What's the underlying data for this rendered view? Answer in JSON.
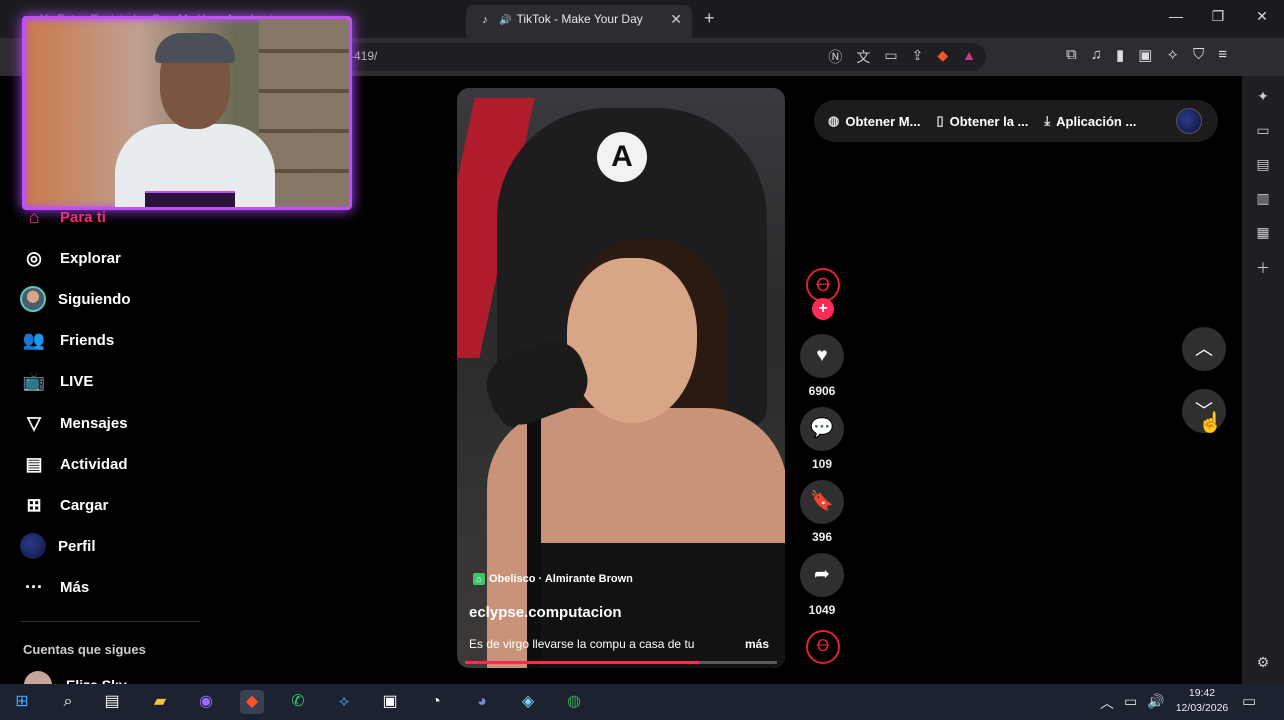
{
  "browser": {
    "inactive_tab_title": "Ya Estoy Enviciado . D ... My Hero Academia",
    "active_tab_title": "TikTok - Make Your Day",
    "tab_close": "✕",
    "new_tab": "+",
    "url": "...-419/",
    "window_controls": {
      "minimize": "—",
      "maximize": "❐",
      "close": "✕"
    }
  },
  "webcam_overlay": {
    "accent_color": "#c44dff"
  },
  "nav": {
    "items": [
      {
        "label": "Para ti",
        "icon": "home-icon",
        "active": true
      },
      {
        "label": "Explorar",
        "icon": "compass-icon"
      },
      {
        "label": "Siguiendo",
        "icon": "avatar"
      },
      {
        "label": "Friends",
        "icon": "friends-icon"
      },
      {
        "label": "LIVE",
        "icon": "live-icon"
      },
      {
        "label": "Mensajes",
        "icon": "send-icon"
      },
      {
        "label": "Actividad",
        "icon": "activity-icon"
      },
      {
        "label": "Cargar",
        "icon": "upload-icon"
      },
      {
        "label": "Perfil",
        "icon": "avatar"
      },
      {
        "label": "Más",
        "icon": "more-icon"
      }
    ],
    "following_title": "Cuentas que sigues",
    "following_users": [
      {
        "name": "Eliza Sky"
      }
    ]
  },
  "top_actions": {
    "items": [
      {
        "label": "Obtener M...",
        "icon": "coin-icon"
      },
      {
        "label": "Obtener la ...",
        "icon": "phone-icon"
      },
      {
        "label": "Aplicación ...",
        "icon": "download-icon"
      }
    ]
  },
  "video": {
    "location_tag": "Obelisco · Almirante Brown",
    "username": "eclypse.computacion",
    "caption": "Es de virgo llevarse la compu a casa de tu",
    "more_label": "más",
    "progress": 0.75,
    "chair_logo": "A"
  },
  "actions": {
    "likes": "6906",
    "comments": "109",
    "saves": "396",
    "shares": "1049"
  },
  "taskbar": {
    "time": "19:42",
    "date": "12/03/2026"
  },
  "colors": {
    "accent": "#fe2c55",
    "webcam_border": "#c44dff",
    "brave": "#fb542b"
  }
}
